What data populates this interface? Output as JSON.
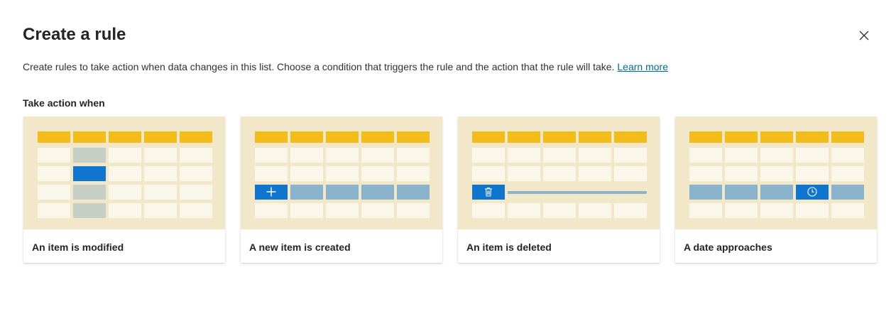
{
  "dialog": {
    "title": "Create a rule",
    "close_icon": "close-icon",
    "description": "Create rules to take action when data changes in this list. Choose a condition that triggers the rule and the action that the rule will take.",
    "learn_more": "Learn more",
    "section_label": "Take action when"
  },
  "cards": [
    {
      "label": "An item is modified",
      "icon": "none"
    },
    {
      "label": "A new item is created",
      "icon": "plus-icon"
    },
    {
      "label": "An item is deleted",
      "icon": "trash-icon"
    },
    {
      "label": "A date approaches",
      "icon": "clock-icon"
    }
  ],
  "colors": {
    "art_background": "#f2e8c9",
    "header_cell": "#f2bc1b",
    "empty_cell": "#fbf6ea",
    "highlight_gray": "#c6d0c7",
    "accent_blue": "#0f75cf",
    "row_blue": "#89b4cc",
    "link": "#006e8f"
  }
}
